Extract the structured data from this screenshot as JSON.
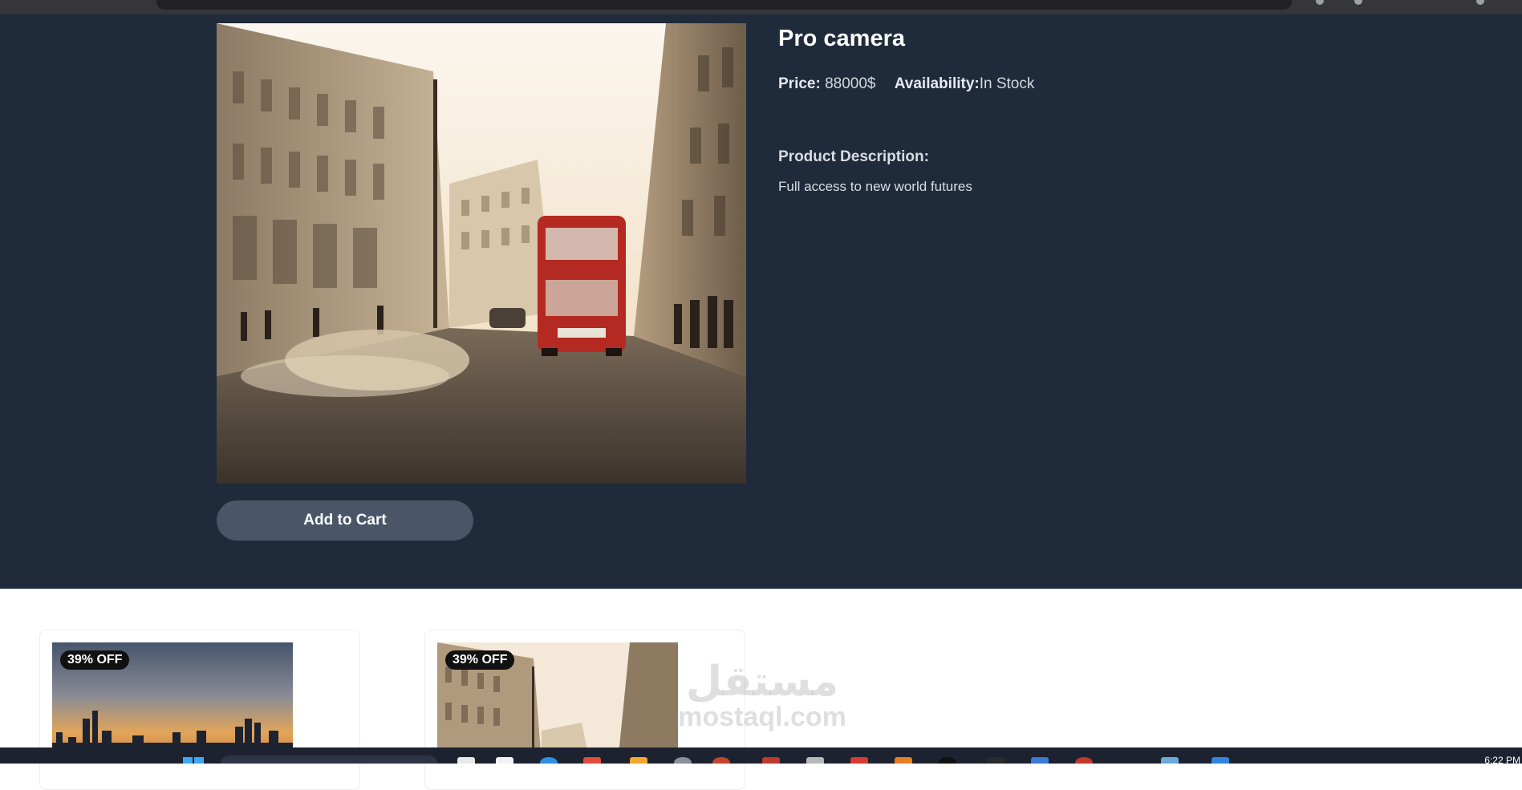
{
  "product": {
    "title": "Pro camera",
    "price_label": "Price:",
    "price_value": "88000$",
    "availability_label": "Availability:",
    "availability_value": "In Stock",
    "description_heading": "Product Description:",
    "description_text": "Full access to new world futures",
    "add_to_cart_label": "Add to Cart"
  },
  "related": {
    "cards": [
      {
        "badge": "39% OFF",
        "image": "city-skyline-image"
      },
      {
        "badge": "39% OFF",
        "image": "london-street-image"
      }
    ]
  },
  "watermark": {
    "arabic": "مستقل",
    "latin": "mostaql.com"
  },
  "taskbar": {
    "clock": "6:22 PM"
  },
  "colors": {
    "section_bg": "#1f2a3a",
    "button_bg": "#4a5668",
    "badge_bg": "#111111"
  }
}
